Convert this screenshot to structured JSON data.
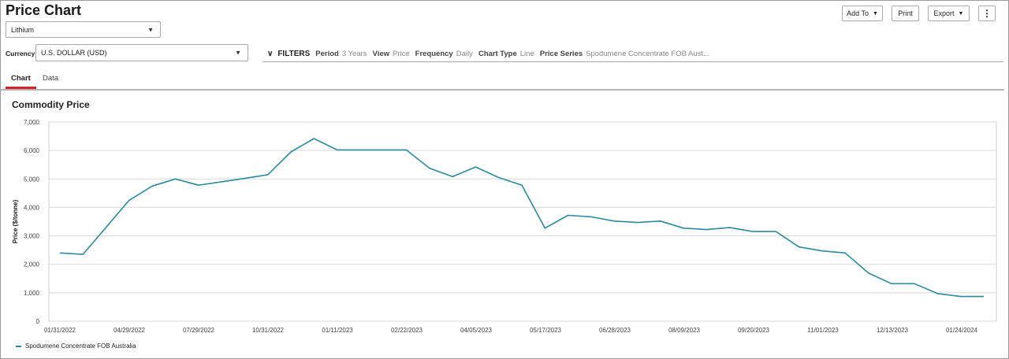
{
  "page": {
    "title": "Price Chart"
  },
  "commodity": {
    "selected": "Lithium"
  },
  "currency": {
    "label": "Currency",
    "selected": "U.S. DOLLAR (USD)"
  },
  "toolbar": {
    "add_to": "Add To",
    "print": "Print",
    "export": "Export"
  },
  "filters": {
    "title": "FILTERS",
    "items": [
      {
        "key": "Period",
        "value": "3 Years"
      },
      {
        "key": "View",
        "value": "Price"
      },
      {
        "key": "Frequency",
        "value": "Daily"
      },
      {
        "key": "Chart Type",
        "value": "Line"
      },
      {
        "key": "Price Series",
        "value": "Spodumene Concentrate FOB Aust..."
      }
    ]
  },
  "tabs": [
    {
      "label": "Chart",
      "active": true
    },
    {
      "label": "Data",
      "active": false
    }
  ],
  "chart_data": {
    "type": "line",
    "title": "Commodity Price",
    "xlabel": "",
    "ylabel": "Price ($/tonne)",
    "ylim": [
      0,
      7000
    ],
    "yticks": [
      "0",
      "1,000",
      "2,000",
      "3,000",
      "4,000",
      "5,000",
      "6,000",
      "7,000"
    ],
    "ytick_values": [
      0,
      1000,
      2000,
      3000,
      4000,
      5000,
      6000,
      7000
    ],
    "xtick_labels": [
      "01/31/2022",
      "04/29/2022",
      "07/29/2022",
      "10/31/2022",
      "01/11/2023",
      "02/22/2023",
      "04/05/2023",
      "05/17/2023",
      "06/28/2023",
      "08/09/2023",
      "09/20/2023",
      "11/01/2023",
      "12/13/2023",
      "01/24/2024"
    ],
    "grid": true,
    "legend": "bottom-left",
    "colors": {
      "line": "#2a8ba0",
      "grid": "#d9d9d9",
      "accent": "#d2232a"
    },
    "series": [
      {
        "name": "Spodumene Concentrate FOB Australia",
        "values": [
          2400,
          2350,
          3300,
          4250,
          4750,
          5000,
          4780,
          4900,
          5020,
          5150,
          5950,
          6420,
          6020,
          6020,
          6020,
          6020,
          5380,
          5080,
          5420,
          5050,
          4780,
          3270,
          3720,
          3670,
          3520,
          3470,
          3520,
          3270,
          3220,
          3290,
          3150,
          3150,
          2610,
          2470,
          2400,
          1700,
          1320,
          1320,
          970,
          870,
          870
        ]
      }
    ]
  }
}
